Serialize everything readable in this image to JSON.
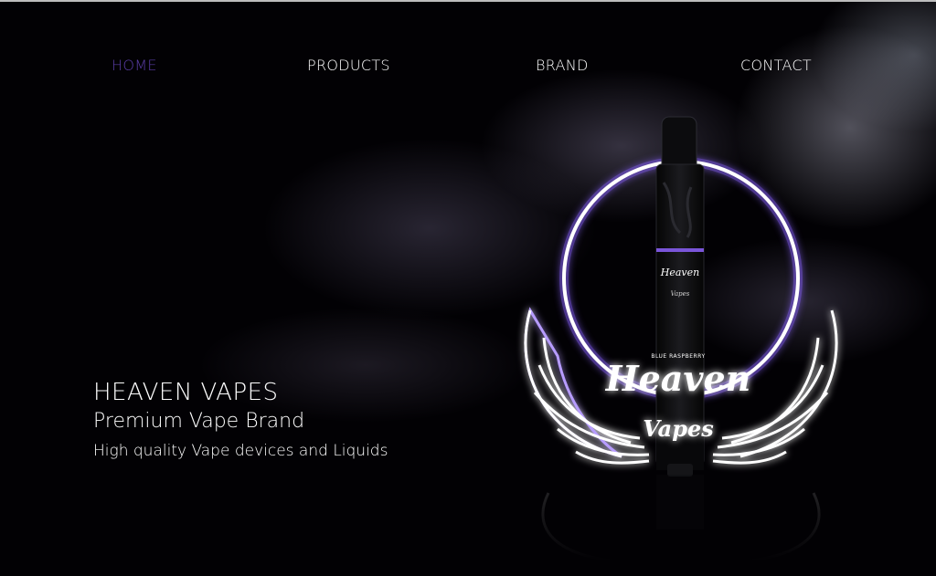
{
  "nav": {
    "items": [
      {
        "label": "HOME",
        "active": true
      },
      {
        "label": "PRODUCTS",
        "active": false
      },
      {
        "label": "BRAND",
        "active": false
      },
      {
        "label": "CONTACT",
        "active": false
      }
    ]
  },
  "hero": {
    "title": "HEAVEN VAPES",
    "subtitle": "Premium Vape Brand",
    "description": "High quality Vape devices and Liquids"
  },
  "product": {
    "logo_text_main": "Heaven",
    "logo_text_sub": "Vapes",
    "flavor_label": "BLUE RASPBERRY",
    "device_logo_main": "Heaven",
    "device_logo_sub": "Vapes"
  },
  "colors": {
    "accent": "#5b3ea8",
    "glow": "#8a63ff",
    "background": "#020104"
  }
}
